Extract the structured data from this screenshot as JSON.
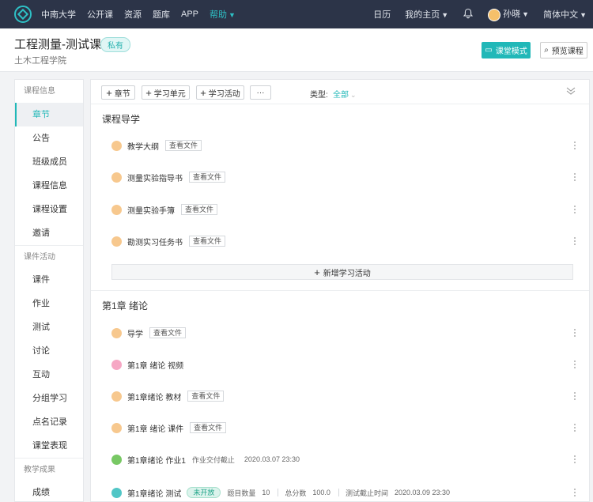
{
  "topnav": {
    "items": [
      "中南大学",
      "公开课",
      "资源",
      "题库",
      "APP",
      "帮助"
    ],
    "active_item": "帮助",
    "right": {
      "calendar": "日历",
      "my_home": "我的主页",
      "user_name": "孙晓",
      "language": "简体中文"
    }
  },
  "header": {
    "course_title": "工程测量-测试课",
    "badge": "私有",
    "college": "土木工程学院",
    "classroom_mode": "课堂模式",
    "preview_course": "预览课程"
  },
  "sidebar": {
    "group1": "课程信息",
    "group1_items": [
      "章节",
      "公告",
      "班级成员",
      "课程信息",
      "课程设置",
      "邀请"
    ],
    "active": "章节",
    "group2": "课件活动",
    "group2_items": [
      "课件",
      "作业",
      "测试",
      "讨论",
      "互动",
      "分组学习",
      "点名记录",
      "课堂表现"
    ],
    "group3": "教学成果",
    "group3_items": [
      "成绩"
    ]
  },
  "toolbar": {
    "chapter": "章节",
    "unit": "学习单元",
    "activity": "学习活动",
    "more": "···",
    "type_label": "类型:",
    "type_value": "全部"
  },
  "sections": {
    "guide_title": "课程导学",
    "guide_items": [
      "教学大纲",
      "测量实验指导书",
      "测量实验手簿",
      "勘测实习任务书"
    ],
    "view_file": "查看文件",
    "add_activity": "新增学习活动",
    "ch1_title": "第1章 绪论",
    "ch1": {
      "item1": "导学",
      "item2": "第1章 绪论 视频",
      "item3": "第1章绪论 教材",
      "item4": "第1章 绪论 课件",
      "item5": "第1章绪论 作业1",
      "item5_meta_label": "作业交付截止",
      "item5_meta_time": "2020.03.07 23:30",
      "item6": "第1章绪论 测试",
      "item6_status": "未开放",
      "item6_q_label": "题目数量",
      "item6_q_value": "10",
      "item6_score_label": "总分数",
      "item6_score_value": "100.0",
      "item6_deadline_label": "测试截止时间",
      "item6_deadline": "2020.03.09 23:30"
    }
  },
  "colors": {
    "nav_bg": "#2c3448",
    "accent": "#21b8b8"
  }
}
